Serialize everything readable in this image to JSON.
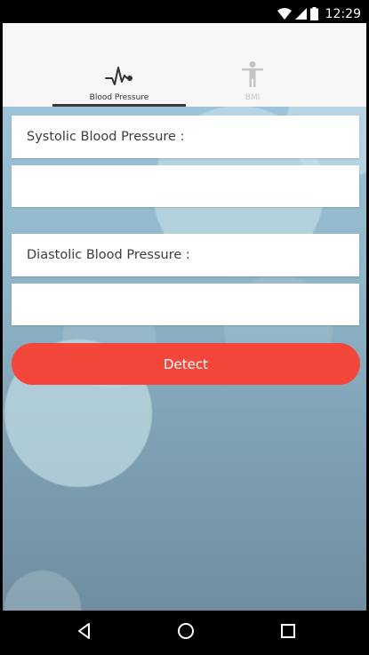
{
  "status_bar": {
    "time": "12:29"
  },
  "tabs": [
    {
      "label": "Blood Pressure",
      "icon": "heartbeat-icon",
      "selected": true
    },
    {
      "label": "BMI",
      "icon": "person-icon",
      "selected": false
    }
  ],
  "form": {
    "systolic_label": "Systolic Blood Pressure :",
    "systolic_value": "",
    "diastolic_label": "Diastolic Blood Pressure :",
    "diastolic_value": "",
    "detect_label": "Detect"
  },
  "colors": {
    "accent": "#f2473a",
    "tab_active": "#333333",
    "tab_inactive": "#c4c4c4"
  },
  "nav_bar": [
    "back-icon",
    "home-icon",
    "recent-apps-icon"
  ]
}
